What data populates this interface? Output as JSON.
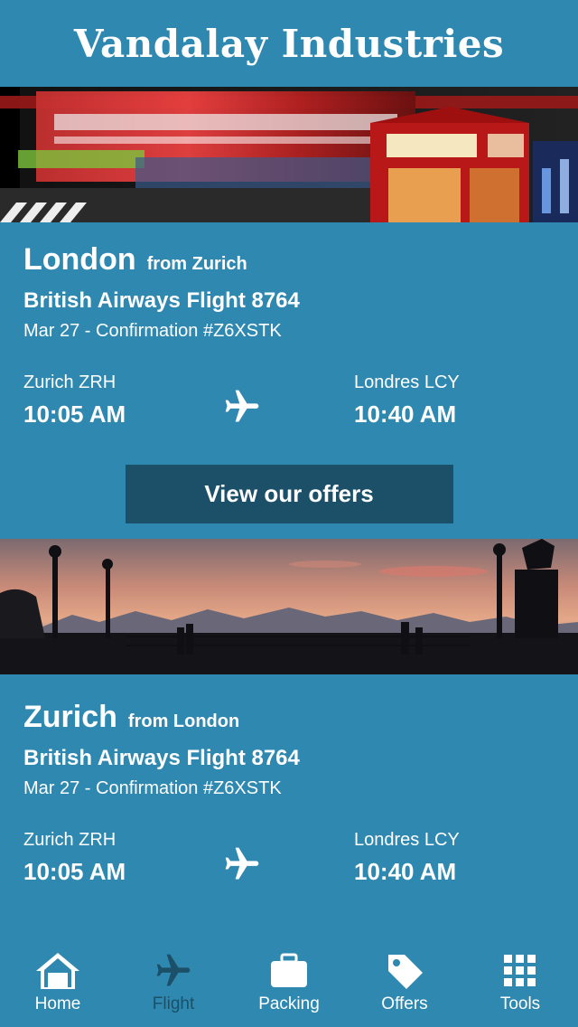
{
  "header": {
    "title": "Vandalay Industries"
  },
  "trips": [
    {
      "destination": "London",
      "origin": "from Zurich",
      "flight": "British Airways Flight 8764",
      "meta": "Mar 27 - Confirmation #Z6XSTK",
      "depart_airport": "Zurich ZRH",
      "depart_time": "10:05 AM",
      "arrive_airport": "Londres LCY",
      "arrive_time": "10:40 AM",
      "button": "View our offers",
      "hero_icon": "london-street-photo"
    },
    {
      "destination": "Zurich",
      "origin": "from London",
      "flight": "British Airways Flight 8764",
      "meta": "Mar 27 - Confirmation #Z6XSTK",
      "depart_airport": "Zurich ZRH",
      "depart_time": "10:05 AM",
      "arrive_airport": "Londres LCY",
      "arrive_time": "10:40 AM",
      "hero_icon": "zurich-sunset-photo"
    }
  ],
  "tabs": [
    {
      "label": "Home",
      "icon": "home-icon"
    },
    {
      "label": "Flight",
      "icon": "airplane-icon",
      "active": true
    },
    {
      "label": "Packing",
      "icon": "briefcase-icon"
    },
    {
      "label": "Offers",
      "icon": "tag-icon"
    },
    {
      "label": "Tools",
      "icon": "grid-icon"
    }
  ],
  "colors": {
    "background": "#2e88b0",
    "button": "#1b5068",
    "active_tab": "#1b5068"
  }
}
